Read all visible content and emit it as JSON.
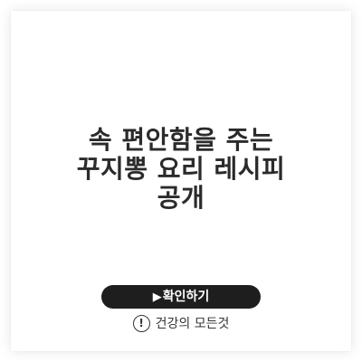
{
  "headline": {
    "line1": "속 편안함을 주는",
    "line2": "꾸지뽕 요리 레시피",
    "line3": "공개"
  },
  "cta": {
    "play_icon": "▶",
    "label": "확인하기"
  },
  "site": {
    "icon": "!",
    "label": "건강의 모든것"
  }
}
